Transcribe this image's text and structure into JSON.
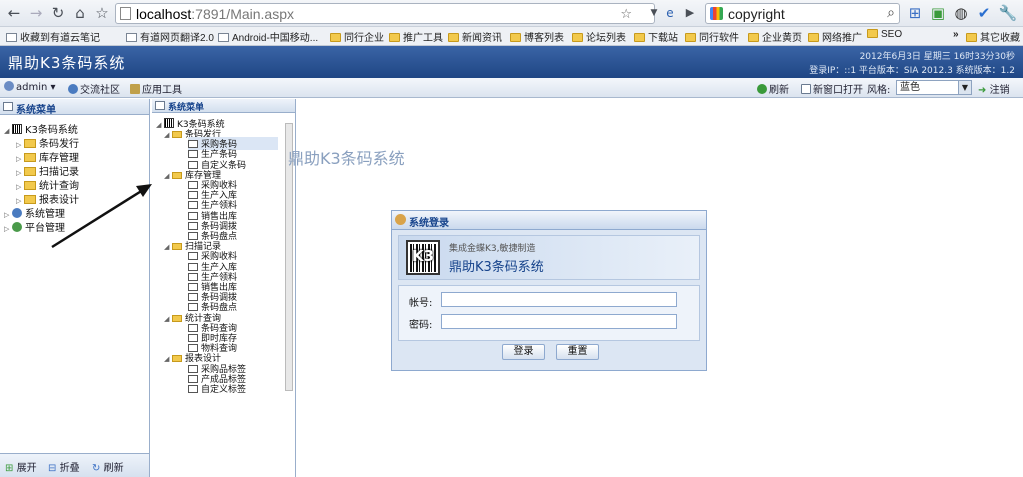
{
  "browser": {
    "url_host": "localhost",
    "url_path": ":7891/Main.aspx",
    "search_query": "copyright",
    "bookmarks": [
      "收藏到有道云笔记",
      "有道网页翻译2.0",
      "Android-中国移动...",
      "同行企业",
      "推广工具",
      "新闻资讯",
      "博客列表",
      "论坛列表",
      "下载站",
      "同行软件",
      "企业黄页",
      "网络推广",
      "SEO"
    ],
    "bookmarks_more": "»",
    "other_bookmarks": "其它收藏"
  },
  "header": {
    "title": "鼎助K3条码系统",
    "date": "2012年6月3日  星期三  16时33分30秒",
    "info": "登录IP：::1  平台版本：SIA 2012.3  系统版本：1.2"
  },
  "toolbar": {
    "user": "admin",
    "community": "交流社区",
    "apps": "应用工具",
    "refresh": "刷新",
    "new_window": "新窗口打开",
    "style_label": "风格:",
    "style_value": "蓝色",
    "logout": "注销"
  },
  "left_panel": {
    "title": "系统菜单",
    "root": "K3条码系统",
    "items": [
      "条码发行",
      "库存管理",
      "扫描记录",
      "统计查询",
      "报表设计"
    ],
    "system": "系统管理",
    "platform": "平台管理",
    "footer": {
      "expand": "展开",
      "collapse": "折叠",
      "refresh": "刷新"
    }
  },
  "mid_panel": {
    "title": "系统菜单",
    "root": "K3条码系统",
    "groups": [
      {
        "name": "条码发行",
        "items": [
          "采购条码",
          "生产条码",
          "自定义条码"
        ]
      },
      {
        "name": "库存管理",
        "items": [
          "采购收料",
          "生产入库",
          "生产领料",
          "销售出库",
          "条码调拨",
          "条码盘点"
        ]
      },
      {
        "name": "扫描记录",
        "items": [
          "采购收料",
          "生产入库",
          "生产领料",
          "销售出库",
          "条码调拨",
          "条码盘点"
        ]
      },
      {
        "name": "统计查询",
        "items": [
          "条码查询",
          "即时库存",
          "物料查询"
        ]
      },
      {
        "name": "报表设计",
        "items": [
          "采购品标签",
          "产成品标签",
          "自定义标签"
        ]
      }
    ]
  },
  "main": {
    "welcome": "鼎助K3条码系统"
  },
  "dialog": {
    "title": "系统登录",
    "subtitle": "集成金蝶K3,敏捷制造",
    "system_name": "鼎助K3条码系统",
    "logo_text": "K3",
    "account_label": "帐号:",
    "password_label": "密码:",
    "login_button": "登录",
    "reset_button": "重置"
  }
}
